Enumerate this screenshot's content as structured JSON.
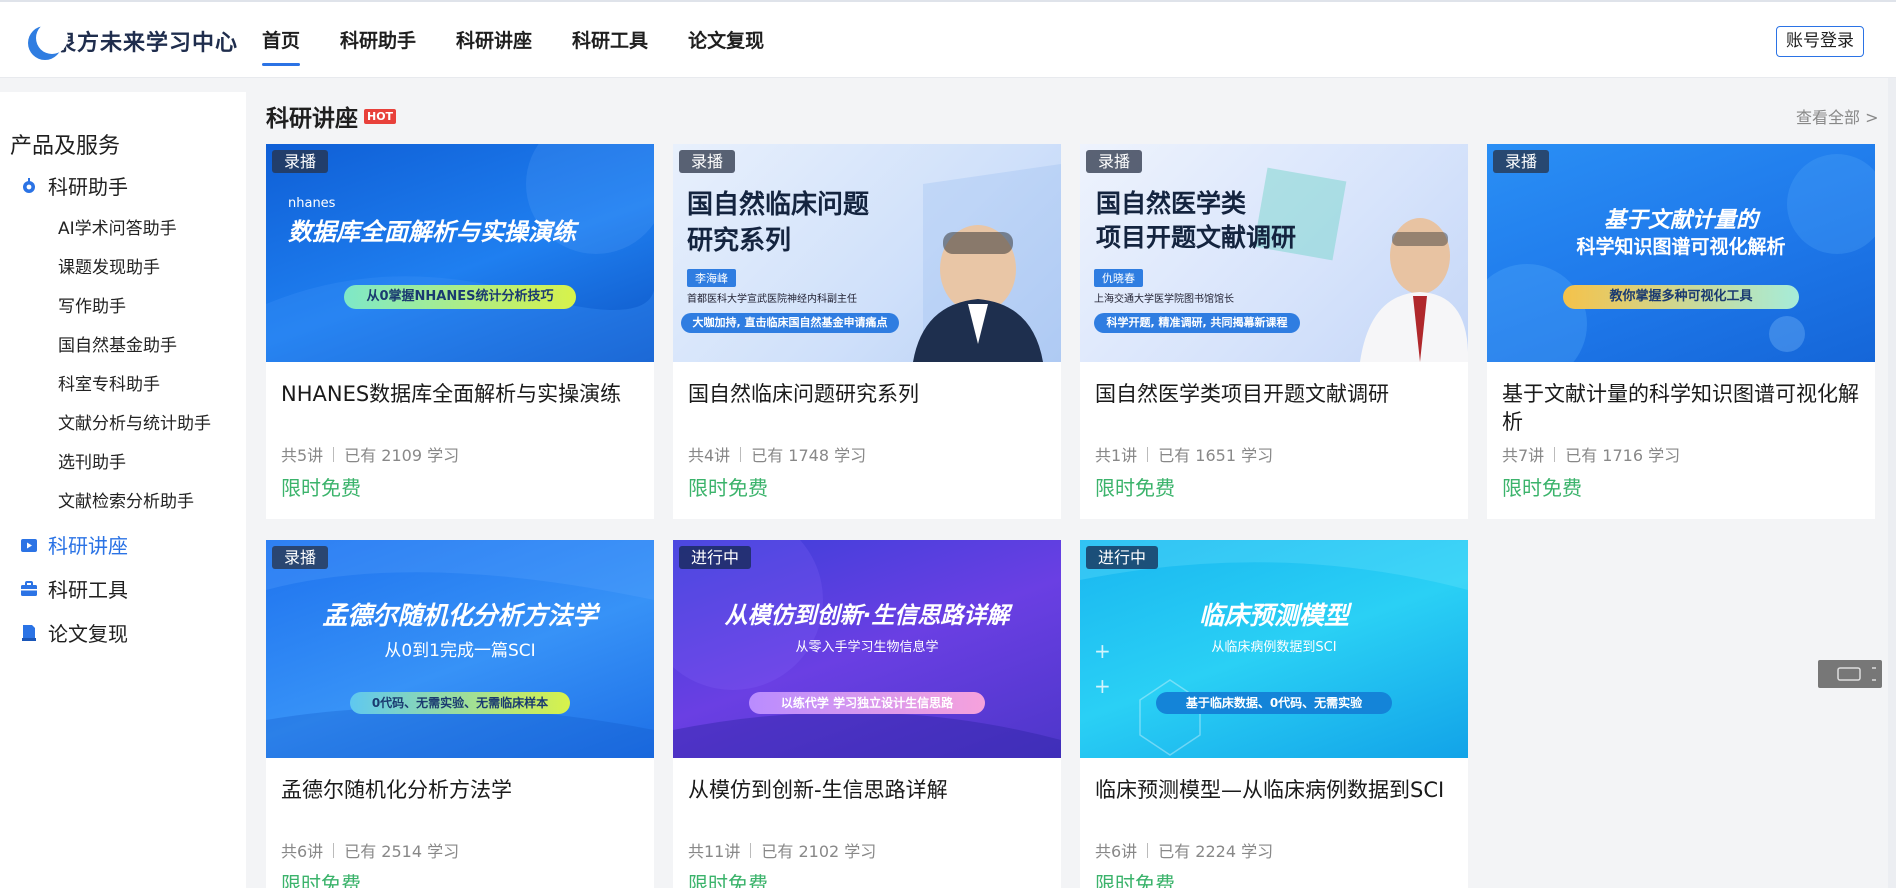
{
  "header": {
    "logo_text": "泉方未来学习中心",
    "nav": [
      "首页",
      "科研助手",
      "科研讲座",
      "科研工具",
      "论文复现"
    ],
    "login_label": "账号登录"
  },
  "sidebar": {
    "title": "产品及服务",
    "groups": [
      {
        "label": "科研助手",
        "icon": "gear-icon"
      },
      {
        "label": "科研讲座",
        "icon": "video-icon"
      },
      {
        "label": "科研工具",
        "icon": "toolbox-icon"
      },
      {
        "label": "论文复现",
        "icon": "document-icon"
      }
    ],
    "assistant_items": [
      "AI学术问答助手",
      "课题发现助手",
      "写作助手",
      "国自然基金助手",
      "科室专科助手",
      "文献分析与统计助手",
      "选刊助手",
      "文献检索分析助手"
    ]
  },
  "section": {
    "title": "科研讲座",
    "hot": "HOT",
    "view_all": "查看全部 >"
  },
  "cards": [
    {
      "badge": "录播",
      "title": "NHANES数据库全面解析与实操演练",
      "lectures": "共5讲",
      "learners": "已有 2109 学习",
      "price": "限时免费",
      "thumb_small": "nhanes",
      "thumb_title": "数据库全面解析与实操演练",
      "thumb_pill": "从0掌握NHANES统计分析技巧"
    },
    {
      "badge": "录播",
      "title": "国自然临床问题研究系列",
      "lectures": "共4讲",
      "learners": "已有 1748 学习",
      "price": "限时免费",
      "thumb_title1": "国自然临床问题",
      "thumb_title2": "研究系列",
      "thumb_name": "李海峰",
      "thumb_desc": "首都医科大学宣武医院神经内科副主任",
      "thumb_pill": "大咖加持, 直击临床国自然基金申请痛点"
    },
    {
      "badge": "录播",
      "title": "国自然医学类项目开题文献调研",
      "lectures": "共1讲",
      "learners": "已有 1651 学习",
      "price": "限时免费",
      "thumb_title1": "国自然医学类",
      "thumb_title2": "项目开题文献调研",
      "thumb_name": "仇晓春",
      "thumb_desc": "上海交通大学医学院图书馆馆长",
      "thumb_pill": "科学开题, 精准调研, 共同揭幕新课程"
    },
    {
      "badge": "录播",
      "title": "基于文献计量的科学知识图谱可视化解析",
      "lectures": "共7讲",
      "learners": "已有 1716 学习",
      "price": "限时免费",
      "thumb_title1": "基于文献计量的",
      "thumb_title2": "科学知识图谱可视化解析",
      "thumb_pill": "教你掌握多种可视化工具"
    },
    {
      "badge": "录播",
      "title": "孟德尔随机化分析方法学",
      "lectures": "共6讲",
      "learners": "已有 2514 学习",
      "price": "限时免费",
      "thumb_title1": "孟德尔随机化分析方法学",
      "thumb_title2": "从0到1完成一篇SCI",
      "thumb_pill": "0代码、无需实验、无需临床样本"
    },
    {
      "badge": "进行中",
      "title": "从模仿到创新-生信思路详解",
      "lectures": "共11讲",
      "learners": "已有 2102 学习",
      "price": "限时免费",
      "thumb_title1": "从模仿到创新·生信思路详解",
      "thumb_title2": "从零入手学习生物信息学",
      "thumb_pill": "以练代学 学习独立设计生信思路"
    },
    {
      "badge": "进行中",
      "title": "临床预测模型—从临床病例数据到SCI",
      "lectures": "共6讲",
      "learners": "已有 2224 学习",
      "price": "限时免费",
      "thumb_title1": "临床预测模型",
      "thumb_title2": "从临床病例数据到SCI",
      "thumb_pill": "基于临床数据、0代码、无需实验"
    }
  ]
}
